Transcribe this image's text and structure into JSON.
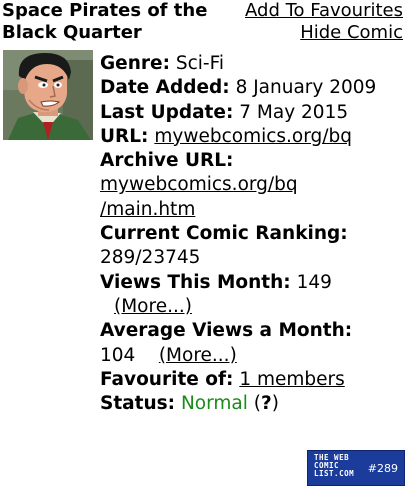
{
  "comic": {
    "title": "Space Pirates of the Black Quarter",
    "add_favourites": "Add To Favourites",
    "hide_comic": "Hide Comic"
  },
  "info": {
    "genre_label": "Genre:",
    "genre_value": "Sci-Fi",
    "date_added_label": "Date Added:",
    "date_added_value": "8 January 2009",
    "last_update_label": "Last Update:",
    "last_update_value": "7 May 2015",
    "url_label": "URL:",
    "url_value": "mywebcomics.org/bq",
    "archive_label": "Archive URL:",
    "archive_value_line1": "mywebcomics.org/bq",
    "archive_value_line2": "/main.htm",
    "ranking_label": "Current Comic Ranking:",
    "ranking_value": "289/23745",
    "views_month_label": "Views This Month:",
    "views_month_value": "149",
    "more_label": "(More...)",
    "avg_views_label": "Average Views a Month:",
    "avg_views_value": "104",
    "favourite_label": "Favourite of:",
    "favourite_value": "1 members",
    "status_label": "Status:",
    "status_value": "Normal",
    "status_help": "?"
  },
  "badge": {
    "line1": "THE WEB",
    "line2": "COMIC",
    "line3": "LIST.COM",
    "rank": "#289"
  },
  "colors": {
    "status_normal": "#1a8a1a",
    "help_mark": "#cc0000",
    "badge_bg": "#1c3c9c"
  },
  "icons": {
    "avatar": "pirate-portrait",
    "help": "question-mark"
  }
}
